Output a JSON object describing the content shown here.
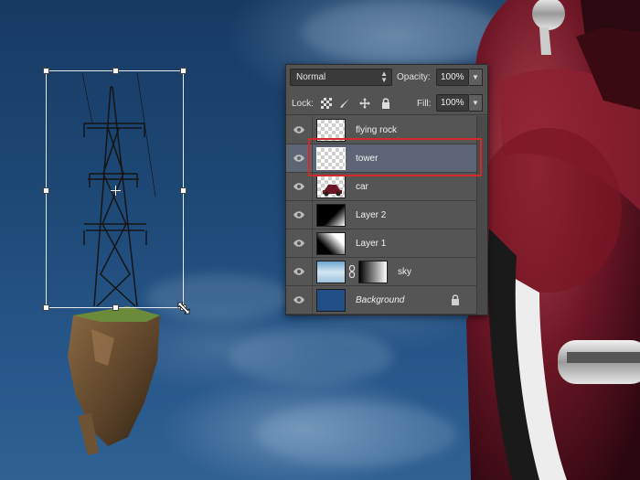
{
  "panel": {
    "blend_mode": "Normal",
    "opacity_label": "Opacity:",
    "opacity_value": "100%",
    "lock_label": "Lock:",
    "fill_label": "Fill:",
    "fill_value": "100%"
  },
  "layers": [
    {
      "name": "flying rock",
      "thumbnail": "transparent",
      "selected": false
    },
    {
      "name": "tower",
      "thumbnail": "transparent",
      "selected": true
    },
    {
      "name": "car",
      "thumbnail": "car",
      "selected": false
    },
    {
      "name": "Layer 2",
      "thumbnail": "gradient-black",
      "selected": false
    },
    {
      "name": "Layer 1",
      "thumbnail": "gradient-white",
      "selected": false
    },
    {
      "name": "sky",
      "thumbnail": "sky-with-mask",
      "selected": false
    },
    {
      "name": "Background",
      "thumbnail": "solid-blue",
      "selected": false,
      "locked": true
    }
  ],
  "icons": {
    "visibility": "eye-icon",
    "lock": "lock-icon",
    "link": "chain-link-icon",
    "lock_transparent": "checkerboard-lock-icon",
    "lock_image": "brush-icon",
    "lock_position": "move-icon",
    "lock_all": "padlock-icon"
  },
  "colors": {
    "panel_bg": "#535353",
    "selected_row": "#5d6574",
    "highlight": "#d62828",
    "background_layer": "#1f4f86"
  }
}
